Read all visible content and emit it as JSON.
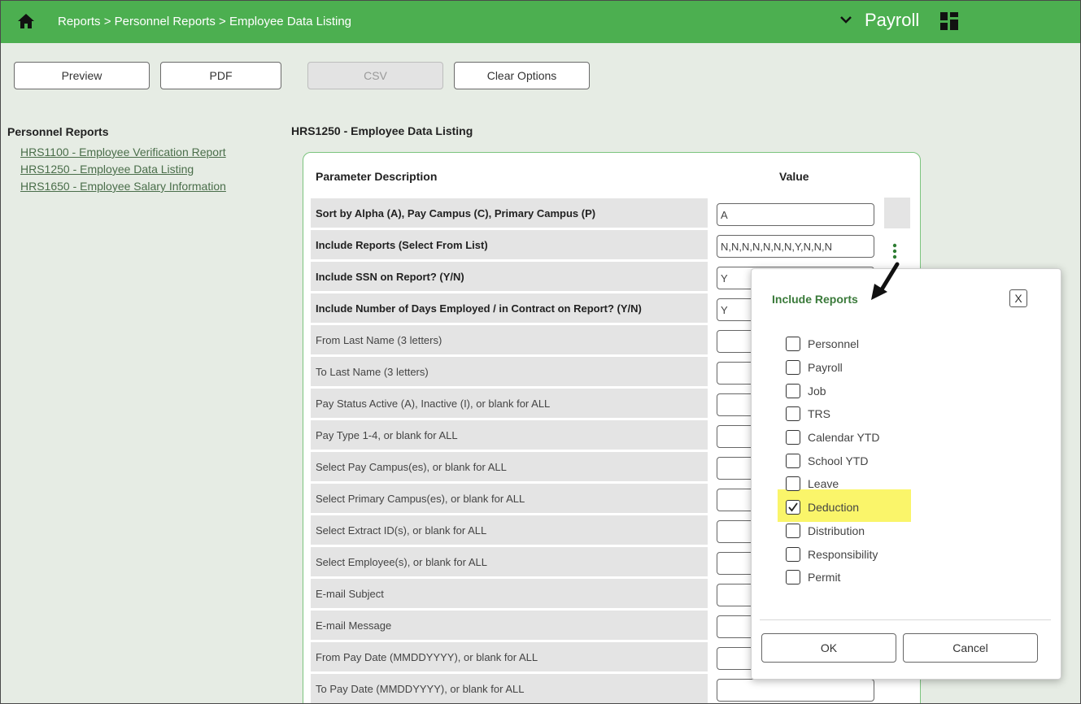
{
  "breadcrumb": "Reports > Personnel Reports > Employee Data Listing",
  "module": "Payroll",
  "icons": {
    "home": "home-icon",
    "chevron": "chevron-down-icon",
    "apps": "grid-icon",
    "menu": "kebab-menu-icon",
    "close": "close-icon"
  },
  "colors": {
    "header_green": "#4caf50",
    "panel_border": "#7cc47f",
    "highlight": "#faf56a",
    "link": "#4a6e4a"
  },
  "toolbar": {
    "preview": "Preview",
    "pdf": "PDF",
    "csv": "CSV",
    "clear": "Clear Options"
  },
  "leftnav": {
    "title": "Personnel Reports",
    "links": [
      "HRS1100 - Employee Verification Report",
      "HRS1250 - Employee Data Listing",
      "HRS1650 - Employee Salary Information"
    ]
  },
  "main": {
    "title": "HRS1250 - Employee Data Listing",
    "header_desc": "Parameter Description",
    "header_value": "Value",
    "params": [
      {
        "desc": "Sort by Alpha (A), Pay Campus (C), Primary Campus (P)",
        "value": "A"
      },
      {
        "desc": "Include Reports (Select From List)",
        "value": "N,N,N,N,N,N,N,Y,N,N,N"
      },
      {
        "desc": "Include SSN on Report? (Y/N)",
        "value": "Y"
      },
      {
        "desc": "Include Number of Days Employed / in Contract on Report? (Y/N)",
        "value": "Y"
      },
      {
        "desc": "From Last Name (3 letters)",
        "value": ""
      },
      {
        "desc": "To Last Name (3 letters)",
        "value": ""
      },
      {
        "desc": "Pay Status Active (A), Inactive (I), or blank for ALL",
        "value": ""
      },
      {
        "desc": "Pay Type 1-4, or blank for ALL",
        "value": ""
      },
      {
        "desc": "Select Pay Campus(es), or blank for ALL",
        "value": ""
      },
      {
        "desc": "Select Primary Campus(es), or blank for ALL",
        "value": ""
      },
      {
        "desc": "Select Extract ID(s), or blank for ALL",
        "value": ""
      },
      {
        "desc": "Select Employee(s), or blank for ALL",
        "value": ""
      },
      {
        "desc": "E-mail Subject",
        "value": ""
      },
      {
        "desc": "E-mail Message",
        "value": ""
      },
      {
        "desc": "From Pay Date (MMDDYYYY), or blank for ALL",
        "value": ""
      },
      {
        "desc": "To Pay Date (MMDDYYYY), or blank for ALL",
        "value": ""
      }
    ]
  },
  "modal": {
    "title": "Include Reports",
    "close": "X",
    "items": [
      {
        "label": "Personnel",
        "checked": false
      },
      {
        "label": "Payroll",
        "checked": false
      },
      {
        "label": "Job",
        "checked": false
      },
      {
        "label": "TRS",
        "checked": false
      },
      {
        "label": "Calendar YTD",
        "checked": false
      },
      {
        "label": "School YTD",
        "checked": false
      },
      {
        "label": "Leave",
        "checked": false
      },
      {
        "label": "Deduction",
        "checked": true
      },
      {
        "label": "Distribution",
        "checked": false
      },
      {
        "label": "Responsibility",
        "checked": false
      },
      {
        "label": "Permit",
        "checked": false
      }
    ],
    "ok": "OK",
    "cancel": "Cancel"
  }
}
